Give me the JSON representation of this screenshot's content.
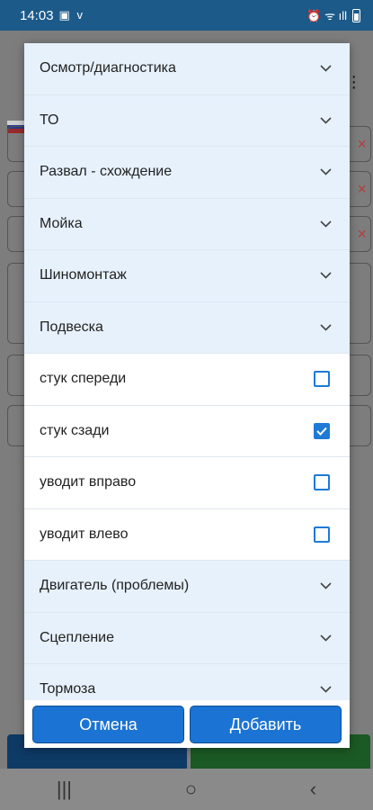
{
  "status_bar": {
    "time": "14:03",
    "left_icons": "▣ ᴠ",
    "right_icons": "⏰ ᯤ ıll"
  },
  "dialog": {
    "items": [
      {
        "type": "category",
        "label": "Осмотр/диагностика"
      },
      {
        "type": "category",
        "label": "ТО"
      },
      {
        "type": "category",
        "label": "Развал - схождение"
      },
      {
        "type": "category",
        "label": "Мойка"
      },
      {
        "type": "category",
        "label": "Шиномонтаж"
      },
      {
        "type": "category",
        "label": "Подвеска"
      },
      {
        "type": "option",
        "label": "стук спереди",
        "checked": false
      },
      {
        "type": "option",
        "label": "стук сзади",
        "checked": true
      },
      {
        "type": "option",
        "label": "уводит вправо",
        "checked": false
      },
      {
        "type": "option",
        "label": "уводит влево",
        "checked": false
      },
      {
        "type": "category",
        "label": "Двигатель (проблемы)"
      },
      {
        "type": "category",
        "label": "Сцепление"
      },
      {
        "type": "category",
        "label": "Тормоза"
      }
    ],
    "cancel_label": "Отмена",
    "add_label": "Добавить"
  },
  "navbar": {
    "recent": "|||",
    "home": "○",
    "back": "‹"
  },
  "colors": {
    "accent": "#1e7ad6",
    "category_bg": "#e6f1fc",
    "status_bar": "#1c5a8a"
  }
}
